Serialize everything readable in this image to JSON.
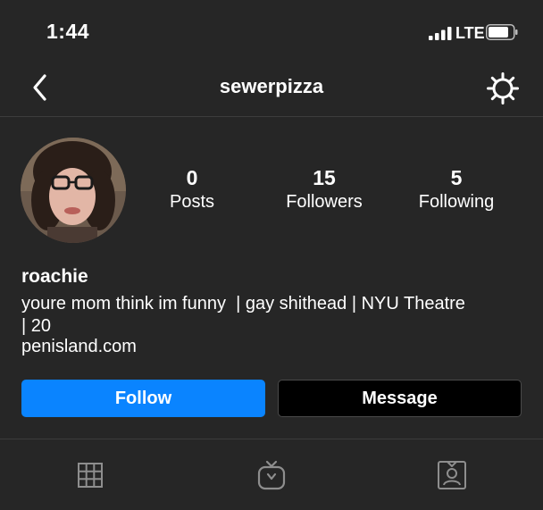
{
  "status": {
    "time": "1:44",
    "carrier": "LTE"
  },
  "nav": {
    "title": "sewerpizza",
    "back_icon": "chevron-left-icon",
    "settings_icon": "gear-icon"
  },
  "stats": [
    {
      "value": "0",
      "label": "Posts"
    },
    {
      "value": "15",
      "label": "Followers"
    },
    {
      "value": "5",
      "label": "Following"
    }
  ],
  "profile": {
    "name": "roachie",
    "bio_line1": "youre mom think im funny  | gay shithead | NYU Theatre",
    "bio_line2": "| 20",
    "link": "penisland.com"
  },
  "actions": {
    "follow_label": "Follow",
    "message_label": "Message"
  },
  "tabs": [
    {
      "icon": "grid-icon"
    },
    {
      "icon": "igtv-icon"
    },
    {
      "icon": "tagged-icon"
    }
  ],
  "colors": {
    "background": "#262626",
    "follow_button": "#0a84ff",
    "message_button": "#000000",
    "divider": "#3c3c3c",
    "tab_icon": "#8e8e8e"
  }
}
